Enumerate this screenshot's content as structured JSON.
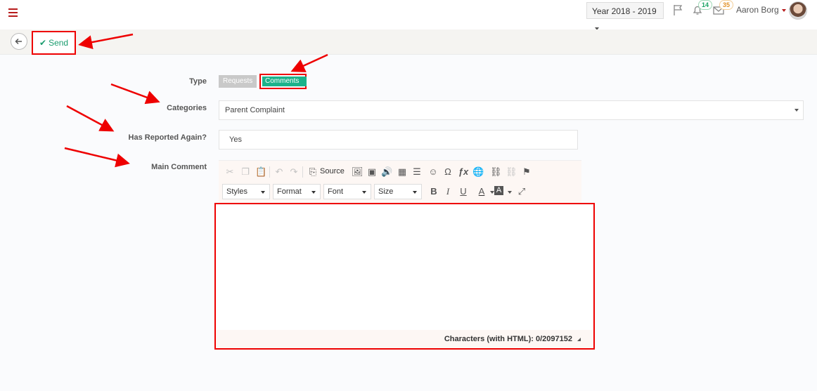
{
  "header": {
    "year": "Year 2018 - 2019",
    "notifications_count": "14",
    "messages_count": "35",
    "user_name": "Aaron Borg"
  },
  "toolbar": {
    "send_label": "Send"
  },
  "form": {
    "type_label": "Type",
    "type_options": [
      "Requests",
      "Comments"
    ],
    "type_selected": "Comments",
    "categories_label": "Categories",
    "categories_value": "Parent Complaint",
    "reported_again_label": "Has Reported Again?",
    "reported_again_value": "Yes",
    "main_comment_label": "Main Comment"
  },
  "editor": {
    "source_label": "Source",
    "dropdowns": [
      "Styles",
      "Format",
      "Font",
      "Size"
    ],
    "char_count": "Characters (with HTML): 0/2097152"
  },
  "colors": {
    "accent": "#1bb28a",
    "brand_red": "#b71c1c",
    "highlight": "#e00000"
  }
}
